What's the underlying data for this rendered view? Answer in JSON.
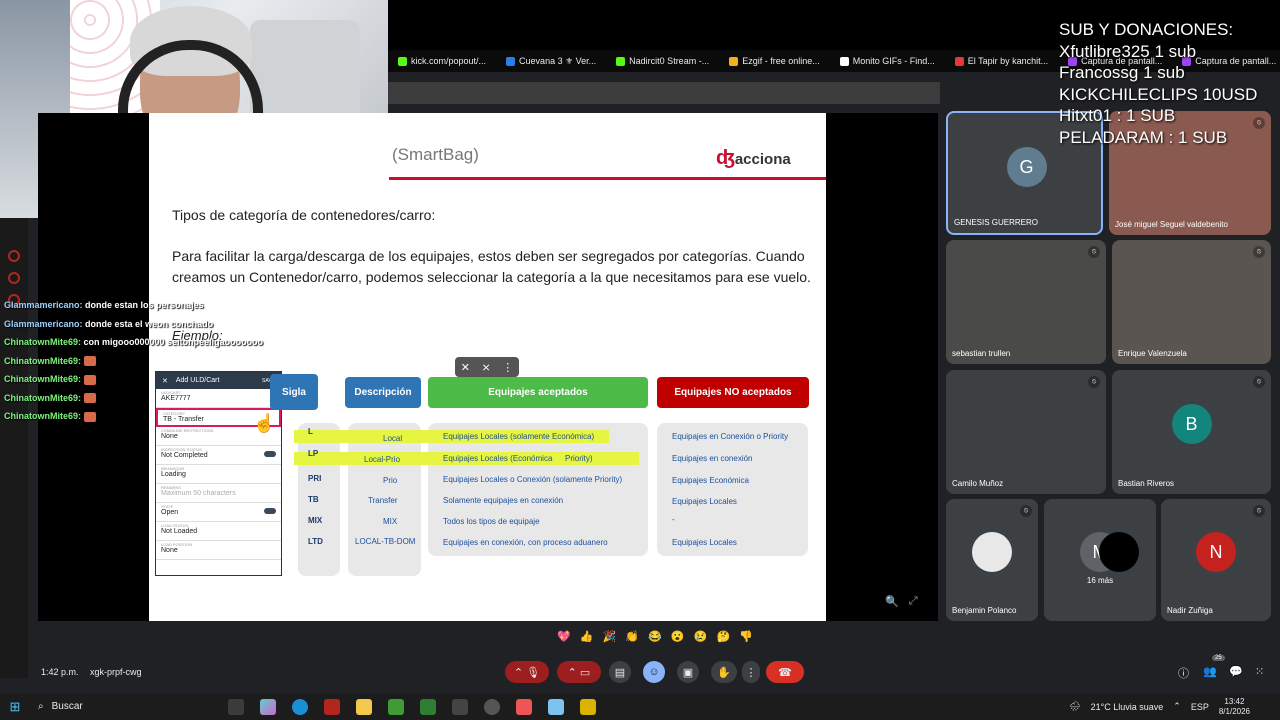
{
  "browser": {
    "bookmarks": [
      {
        "label": "kick.com/popout/...",
        "color": "#53fc18"
      },
      {
        "label": "Cuevana 3 ⚜ Ver...",
        "color": "#2b7de9"
      },
      {
        "label": "Nadircit0 Stream -...",
        "color": "#53fc18"
      },
      {
        "label": "Ezgif - free online...",
        "color": "#f2b01e"
      },
      {
        "label": "Monito GIFs - Find...",
        "color": "#ffffff"
      },
      {
        "label": "El Tapir by kanchit...",
        "color": "#e53935"
      },
      {
        "label": "Captura de pantall...",
        "color": "#a142f4"
      },
      {
        "label": "Captura de pantall...",
        "color": "#a142f4"
      }
    ]
  },
  "slide": {
    "title": "(SmartBag)",
    "logo": "acciona",
    "heading": "Tipos de categoría de contenedores/carro:",
    "paragraph": "Para facilitar la carga/descarga de los equipajes, estos deben ser segregados por categorías. Cuando creamos un Contenedor/carro, podemos seleccionar la categoría a la que necesitamos para ese vuelo.",
    "ejemplo": "Ejemplo:",
    "phone": {
      "header": "Add ULD/Cart",
      "save": "SAVE",
      "rows": [
        {
          "label": "ULD/CART",
          "value": "AKE7777"
        },
        {
          "label": "CATEGORY",
          "value": "TB - Transfer"
        },
        {
          "label": "COMMLINE RESTRICTIONS",
          "value": "None"
        },
        {
          "label": "INSPECTION STATUS",
          "value": "Not Completed"
        },
        {
          "label": "BEHAVIOUR",
          "value": "Loading"
        },
        {
          "label": "REMARKS",
          "value": "Maximum 50 characters"
        },
        {
          "label": "STATE",
          "value": "Open"
        },
        {
          "label": "LOAD STATUS",
          "value": "Not Loaded"
        },
        {
          "label": "LOAD POSITION",
          "value": "None"
        }
      ]
    },
    "headers": {
      "sigla": "Sigla",
      "descripcion": "Descripción",
      "aceptados": "Equipajes aceptados",
      "no_aceptados": "Equipajes NO aceptados"
    },
    "header_colors": {
      "sigla": "#2e75b6",
      "descripcion": "#2e75b6",
      "aceptados": "#4cbb47",
      "no_aceptados": "#c00000"
    },
    "siglas": [
      "L",
      "LP",
      "PRI",
      "TB",
      "MIX",
      "LTD"
    ],
    "descripciones": [
      "Local",
      "Local-Prio",
      "Prio",
      "Transfer",
      "MIX",
      "LOCAL-TB-DOM"
    ],
    "aceptados": [
      "Equipajes Locales (solamente Económica)",
      "Equipajes Locales (Económica",
      "Equipajes Locales o Conexión (solamente Priority)",
      "Solamente equipajes en conexión",
      "Todos los tipos de equipaje",
      "Equipajes en conexión, con proceso aduanero"
    ],
    "aceptados_extra": "Priority)",
    "no_aceptados": [
      "Equipajes en Conexión o Priority",
      "Equipajes en conexión",
      "Equipajes Económica",
      "Equipajes Locales",
      "-",
      "Equipajes Locales"
    ]
  },
  "chat": [
    {
      "user": "Glammamericano:",
      "text": "donde estan los personajes",
      "emote": false
    },
    {
      "user": "Glammamericano:",
      "text": "donde esta el weon conchado",
      "emote": false
    },
    {
      "user": "ChinatownMite69:",
      "text": "con migooo000000 seitonpeeligaooooooo",
      "emote": false
    },
    {
      "user": "ChinatownMite69:",
      "text": "",
      "emote": true
    },
    {
      "user": "ChinatownMite69:",
      "text": "",
      "emote": true
    },
    {
      "user": "ChinatownMite69:",
      "text": "",
      "emote": true
    },
    {
      "user": "ChinatownMite69:",
      "text": "",
      "emote": true
    }
  ],
  "donations": [
    "SUB Y DONACIONES:",
    "Xfutlibre325 1 sub",
    "Francossg 1 sub",
    "KICKCHILECLIPS 10USD",
    "Hitxt01 : 1 SUB",
    "PELADARAM : 1 SUB"
  ],
  "participants": [
    {
      "name": "GENESIS GUERRERO",
      "initial": "G",
      "avatar_color": "#5f7d8e"
    },
    {
      "name": "José miguel Seguel valdebenito"
    },
    {
      "name": "sebastian trullen"
    },
    {
      "name": "Enrique Valenzuela"
    },
    {
      "name": "Camilo Muñoz"
    },
    {
      "name": "Bastian Riveros",
      "initial": "B",
      "avatar_color": "#12867d"
    },
    {
      "name": "Benjamin Polanco"
    },
    {
      "name": "16 más",
      "initial": "M"
    },
    {
      "name": "Nadir Zuñiga",
      "initial": "N",
      "avatar_color": "#c5221f"
    }
  ],
  "reactions": [
    "💖",
    "👍",
    "🎉",
    "👏",
    "😂",
    "😮",
    "😢",
    "🤔",
    "👎"
  ],
  "controls": {
    "time": "1:42 p.m.",
    "meeting_code": "xgk-prpf-cwg",
    "participant_count": "25"
  },
  "taskbar": {
    "search_placeholder": "Buscar",
    "weather": "21°C  Lluvia suave",
    "language": "ESP",
    "time": "13:42",
    "date": "8/1/2026"
  }
}
